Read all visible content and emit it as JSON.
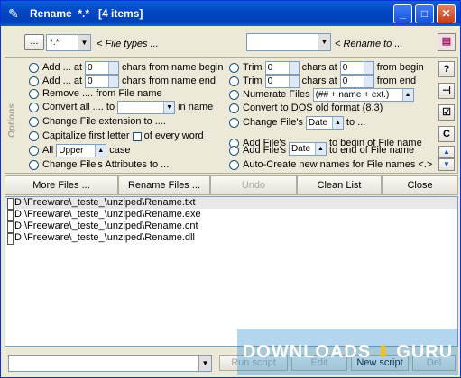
{
  "window": {
    "title": "Rename  *.*   [4 items]",
    "minimize": "_",
    "maximize": "□",
    "close": "✕"
  },
  "top": {
    "browse_label": "...",
    "file_type_value": "*.*",
    "file_types_label": "< File types ...",
    "rename_to_value": "",
    "rename_to_label": "< Rename to ..."
  },
  "options": {
    "group_label": "Options",
    "add1_a": "Add ... at",
    "add1_val": "0",
    "add1_b": "chars from name begin",
    "add2_a": "Add ... at",
    "add2_val": "0",
    "add2_b": "chars from name end",
    "remove": "Remove .... from File name",
    "convert_a": "Convert all .... to",
    "convert_b": "in name",
    "change_ext": "Change File extension to ....",
    "capitalize_a": "Capitalize first letter",
    "capitalize_b": "of every word",
    "all_a": "All",
    "all_val": "Upper",
    "all_b": "case",
    "attributes": "Change File's Attributes to ...",
    "trim1_a": "Trim",
    "trim1_val1": "0",
    "trim1_b": "chars at",
    "trim1_val2": "0",
    "trim1_c": "from begin",
    "trim2_a": "Trim",
    "trim2_val1": "0",
    "trim2_b": "chars at",
    "trim2_val2": "0",
    "trim2_c": "from  end",
    "numerate_a": "Numerate Files",
    "numerate_val": "(## + name + ext.)",
    "dos": "Convert to DOS old format  (8.3)",
    "change_file_a": "Change File's",
    "change_file_val": "Date",
    "change_file_b": "to ...",
    "addfile1_a": "Add File's",
    "addfile1_val": "Date",
    "addfile1_b": "to begin of File name",
    "addfile2_a": "Add File's",
    "addfile2_b": "to end of File name",
    "auto_create": "Auto-Create new names for File names <.>"
  },
  "side": {
    "help": "?",
    "pin": "⊣",
    "check": "☑",
    "c": "C",
    "up": "▲",
    "down": "▼"
  },
  "actions": {
    "more_files": "More Files ...",
    "rename_files": "Rename Files ...",
    "undo": "Undo",
    "clean_list": "Clean List",
    "close": "Close"
  },
  "files": [
    "D:\\Freeware\\_teste_\\unziped\\Rename.txt",
    "D:\\Freeware\\_teste_\\unziped\\Rename.exe",
    "D:\\Freeware\\_teste_\\unziped\\Rename.cnt",
    "D:\\Freeware\\_teste_\\unziped\\Rename.dll"
  ],
  "bottom": {
    "script_value": "",
    "run_script": "Run script",
    "edit": "Edit",
    "new_script": "New script",
    "del": "Del"
  },
  "watermark": {
    "text_a": "DOWNLOADS",
    "text_b": "GURU"
  }
}
